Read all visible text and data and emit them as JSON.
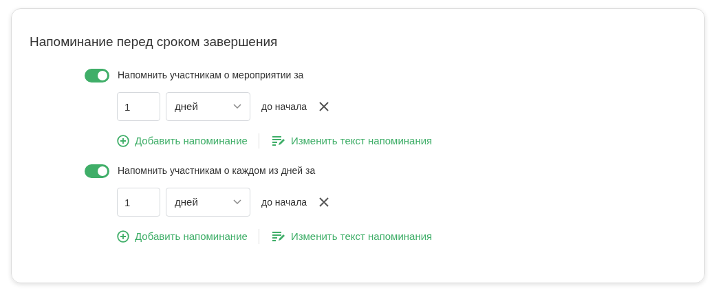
{
  "title": "Напоминание перед сроком завершения",
  "reminders": [
    {
      "on": true,
      "label": "Напомнить участникам о мероприятии за",
      "amount": "1",
      "unit": "дней",
      "suffix": "до начала",
      "add_link": "Добавить напоминание",
      "edit_link": "Изменить текст напоминания"
    },
    {
      "on": true,
      "label": "Напомнить участникам о каждом из дней за",
      "amount": "1",
      "unit": "дней",
      "suffix": "до начала",
      "add_link": "Добавить напоминание",
      "edit_link": "Изменить текст напоминания"
    }
  ]
}
